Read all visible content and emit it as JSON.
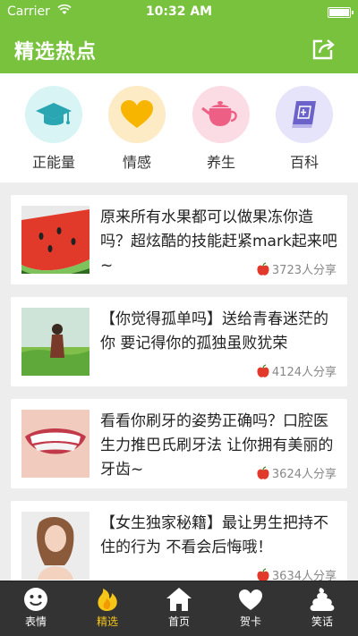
{
  "status": {
    "carrier": "Carrier",
    "time": "10:32 AM"
  },
  "nav": {
    "title": "精选热点"
  },
  "categories": [
    {
      "label": "正能量",
      "icon": "graduation-cap-icon",
      "color": "#d8f4f4"
    },
    {
      "label": "情感",
      "icon": "heart-icon",
      "color": "#fcebc4"
    },
    {
      "label": "养生",
      "icon": "teapot-icon",
      "color": "#fbdce4"
    },
    {
      "label": "百科",
      "icon": "book-icon",
      "color": "#e6e4fa"
    }
  ],
  "articles": [
    {
      "title": "原来所有水果都可以做果冻你造吗？超炫酷的技能赶紧mark起来吧~",
      "shares": "3723人分享",
      "thumb": "watermelon-thumbnail"
    },
    {
      "title": "【你觉得孤单吗】送给青春迷茫的你 要记得你的孤独虽败犹荣",
      "shares": "4124人分享",
      "thumb": "girl-in-field-thumbnail"
    },
    {
      "title": "看看你刷牙的姿势正确吗？口腔医生力推巴氏刷牙法 让你拥有美丽的牙齿~",
      "shares": "3624人分享",
      "thumb": "smile-teeth-thumbnail"
    },
    {
      "title": "【女生独家秘籍】最让男生把持不住的行为 不看会后悔哦！",
      "shares": "3634人分享",
      "thumb": "woman-portrait-thumbnail"
    }
  ],
  "tabs": [
    {
      "label": "表情",
      "icon": "smiley-face-icon"
    },
    {
      "label": "精选",
      "icon": "flame-icon",
      "active": true
    },
    {
      "label": "首页",
      "icon": "home-icon"
    },
    {
      "label": "贺卡",
      "icon": "heart-card-icon"
    },
    {
      "label": "笑话",
      "icon": "poop-icon"
    }
  ],
  "colors": {
    "brand_green": "#78c23e",
    "tabbar_bg": "#333333",
    "active_tab": "#f5c518"
  }
}
